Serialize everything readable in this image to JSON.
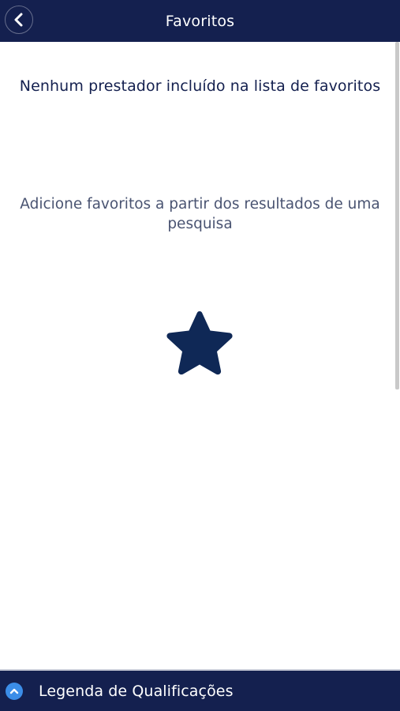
{
  "header": {
    "title": "Favoritos",
    "back_icon": "chevron-left-icon",
    "background": "#14204f"
  },
  "main": {
    "empty_title": "Nenhum prestador incluído na lista de favoritos",
    "empty_hint": "Adicione favoritos a partir dos resultados de uma pesquisa",
    "star_icon": "star-icon",
    "star_color": "#0f2856"
  },
  "footer": {
    "label": "Legenda de Qualificações",
    "icon": "chevron-up-circle-icon",
    "icon_color": "#3b8de8"
  }
}
